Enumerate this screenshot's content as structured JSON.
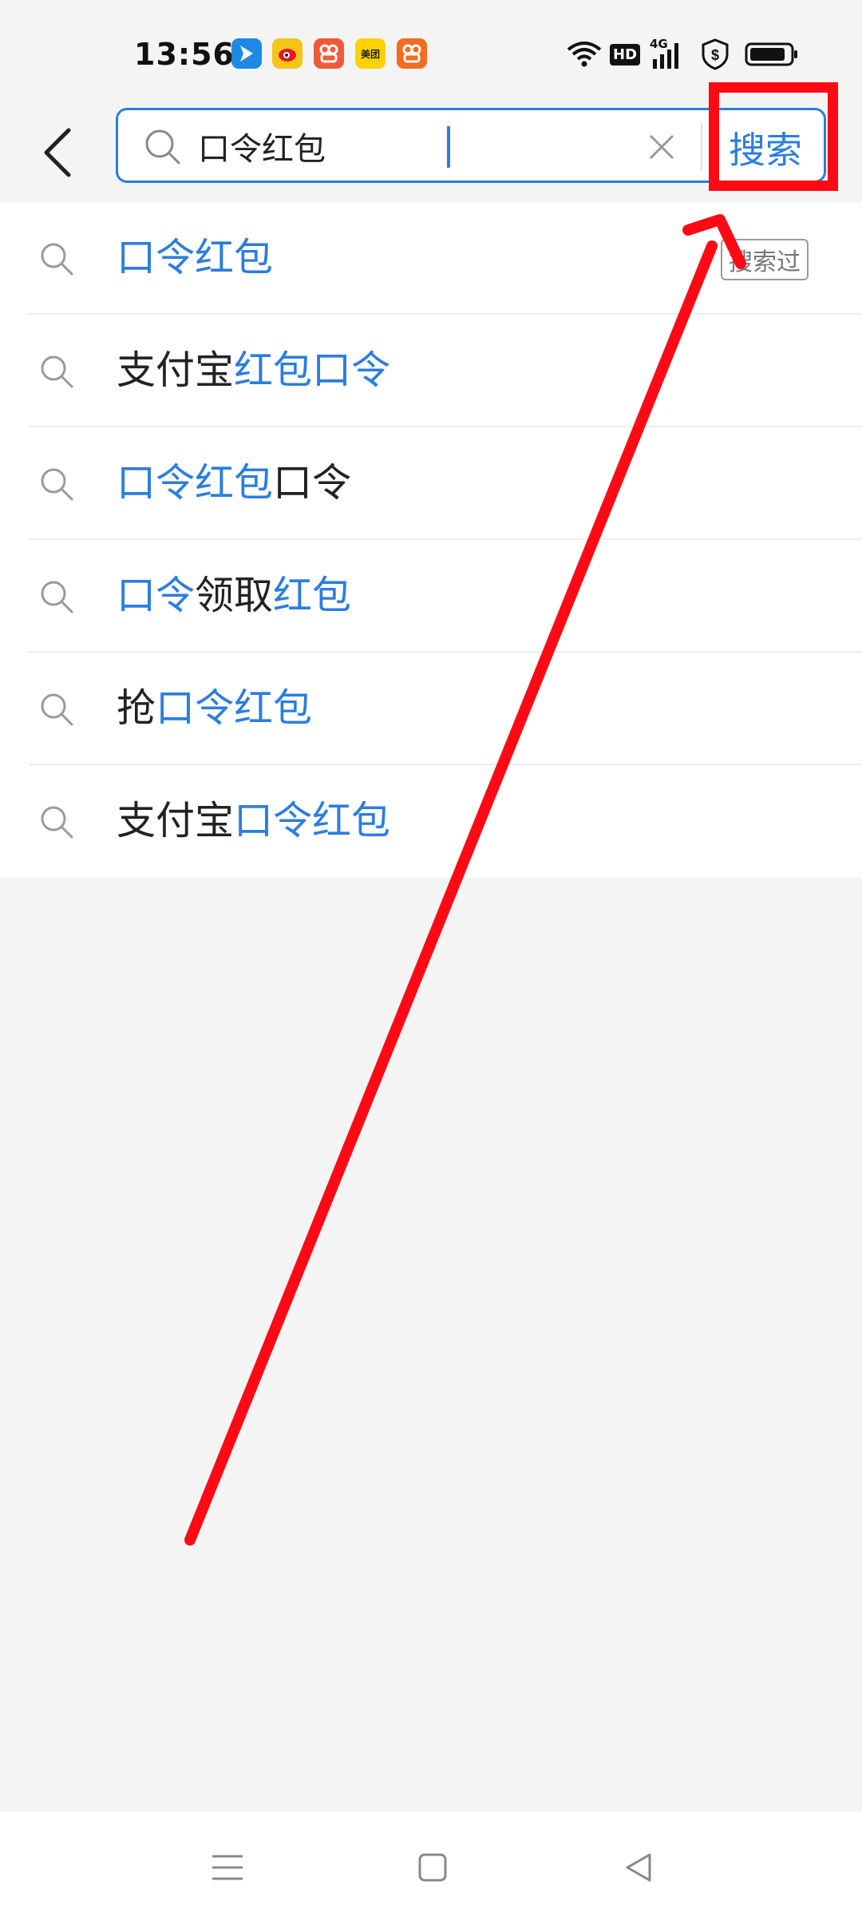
{
  "status_bar": {
    "time": "13:56",
    "app_icons": [
      "feishu-icon",
      "weibo-icon",
      "kuaishou-icon",
      "meituan-icon",
      "kuaishou-icon"
    ],
    "meituan_label": "美团",
    "hd_label": "HD",
    "network_label": "4G"
  },
  "header": {
    "back_icon": "chevron-left-icon",
    "search_value": "口令红包",
    "clear_icon": "close-icon",
    "search_button": "搜索"
  },
  "suggestions": [
    {
      "parts": [
        {
          "t": "口令红包",
          "h": true
        }
      ],
      "tag": "搜索过"
    },
    {
      "parts": [
        {
          "t": "支付宝",
          "h": false
        },
        {
          "t": "红包口令",
          "h": true
        }
      ]
    },
    {
      "parts": [
        {
          "t": "口令红包",
          "h": true
        },
        {
          "t": "口令",
          "h": false
        }
      ]
    },
    {
      "parts": [
        {
          "t": "口令",
          "h": true
        },
        {
          "t": "领取",
          "h": false
        },
        {
          "t": "红包",
          "h": true
        }
      ]
    },
    {
      "parts": [
        {
          "t": "抢",
          "h": false
        },
        {
          "t": "口令红包",
          "h": true
        }
      ]
    },
    {
      "parts": [
        {
          "t": "支付宝",
          "h": false
        },
        {
          "t": "口令红包",
          "h": true
        }
      ]
    }
  ],
  "nav": [
    "menu-icon",
    "home-icon",
    "back-triangle-icon"
  ],
  "colors": {
    "accent": "#2b7de0",
    "annotation": "#ff0a14",
    "background": "#f4f4f4"
  }
}
